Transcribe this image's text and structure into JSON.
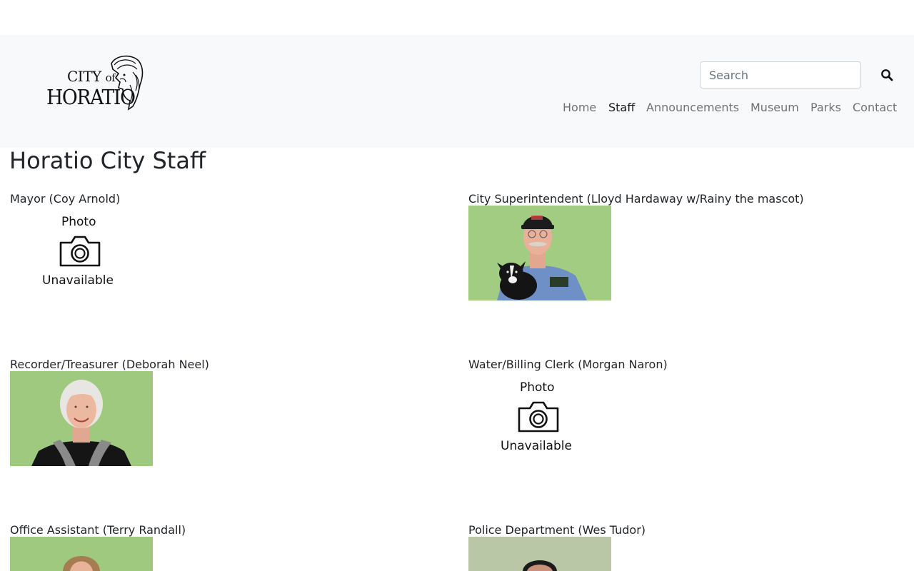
{
  "logo": {
    "city": "CITY",
    "of": "of",
    "name": "HORATIO"
  },
  "search": {
    "placeholder": "Search"
  },
  "nav": {
    "items": [
      "Home",
      "Staff",
      "Announcements",
      "Museum",
      "Parks",
      "Contact"
    ],
    "active": "Staff"
  },
  "page": {
    "title": "Horatio City Staff"
  },
  "photo_unavailable": {
    "top": "Photo",
    "bottom": "Unavailable"
  },
  "staff": [
    {
      "label": "Mayor (Coy Arnold)",
      "photo": "unavailable"
    },
    {
      "label": "City Superintendent (Lloyd Hardaway w/Rainy the mascot)",
      "photo": "available"
    },
    {
      "label": "Recorder/Treasurer (Deborah Neel)",
      "photo": "available"
    },
    {
      "label": "Water/Billing Clerk (Morgan Naron)",
      "photo": "unavailable"
    },
    {
      "label": "Office Assistant (Terry Randall)",
      "photo": "available"
    },
    {
      "label": "Police Department (Wes Tudor)",
      "photo": "available"
    }
  ],
  "colors": {
    "header_bg": "#f8f9fa",
    "photo_bg": "#9fc97f",
    "text": "#212529",
    "nav_muted": "#8c8c8c"
  }
}
